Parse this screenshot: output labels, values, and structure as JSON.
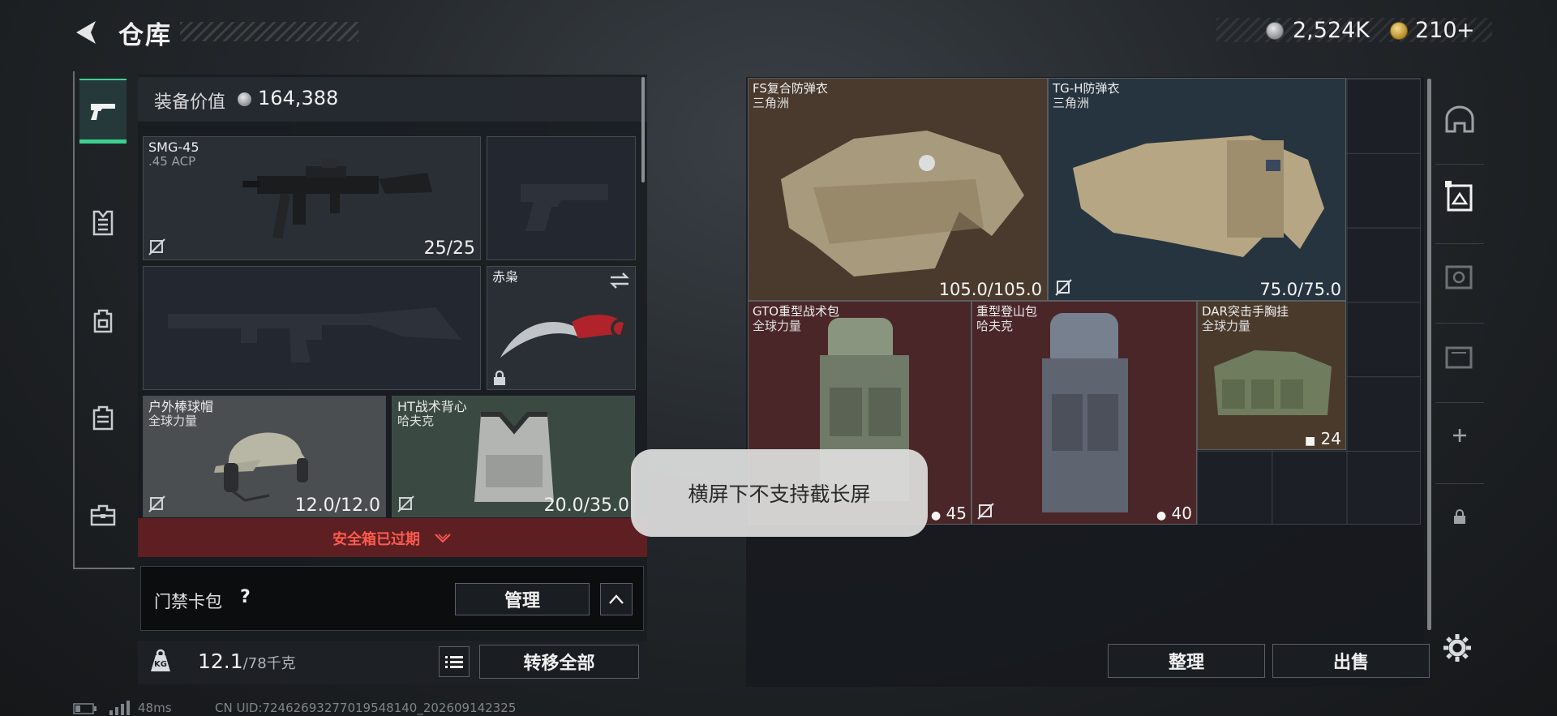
{
  "header": {
    "title": "仓库",
    "currency_primary": "2,524K",
    "currency_secondary": "210",
    "currency_secondary_plus": "+"
  },
  "left_tabs": [
    {
      "icon": "pistol-icon",
      "active": true
    },
    {
      "icon": "armor-vest-icon",
      "active": false
    },
    {
      "icon": "backpack-icon",
      "active": false
    },
    {
      "icon": "case-icon",
      "active": false
    },
    {
      "icon": "toolbox-icon",
      "active": false
    }
  ],
  "equipment": {
    "value_label": "装备价值",
    "value": "164,388",
    "slots": {
      "primary": {
        "name": "SMG-45",
        "ammo": ".45 ACP",
        "count": "25/25"
      },
      "melee": {
        "name": "赤枭"
      },
      "helmet": {
        "name": "户外棒球帽",
        "sub": "全球力量",
        "durability": "12.0/12.0"
      },
      "vest": {
        "name": "HT战术背心",
        "sub": "哈夫克",
        "durability": "20.0/35.0"
      }
    },
    "expired_text": "安全箱已过期",
    "keycard_label": "门禁卡包",
    "keycard_help": "?",
    "manage_button": "管理",
    "weight": "12.1",
    "weight_max": "/78千克",
    "weight_icon_text": "KG",
    "transfer_all_button": "转移全部"
  },
  "storage": {
    "items": [
      {
        "name": "FS复合防弹衣",
        "sub": "三角洲",
        "value": "105.0/105.0",
        "color": "#4a3a2d"
      },
      {
        "name": "TG-H防弹衣",
        "sub": "三角洲",
        "value": "75.0/75.0",
        "color": "#26343f"
      },
      {
        "name": "GTO重型战术包",
        "sub": "全球力量",
        "value": "45",
        "color": "#4a2628"
      },
      {
        "name": "重型登山包",
        "sub": "哈夫克",
        "value": "40",
        "color": "#4a2628"
      },
      {
        "name": "DAR突击手胸挂",
        "sub": "全球力量",
        "value": "24",
        "color": "#4a3a2c"
      }
    ],
    "sort_button": "整理",
    "sell_button": "出售"
  },
  "toast": "横屏下不支持截长屏",
  "status_bar": {
    "ping": "48ms",
    "uid": "CN UID:7246269327701954814​0_202609142325"
  }
}
